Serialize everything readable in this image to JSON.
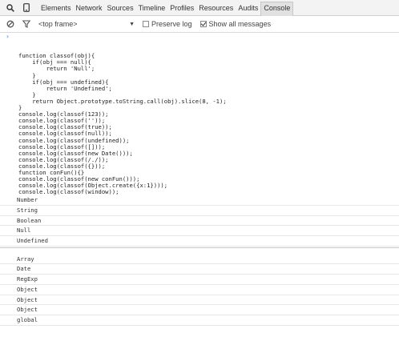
{
  "tabs": [
    "Elements",
    "Network",
    "Sources",
    "Timeline",
    "Profiles",
    "Resources",
    "Audits",
    "Console"
  ],
  "active_tab": "Console",
  "frame_select": "<top frame>",
  "preserve_log": {
    "label": "Preserve log",
    "checked": false
  },
  "show_all": {
    "label": "Show all messages",
    "checked": true
  },
  "code_lines": [
    "function classof(obj){",
    "    if(obj === null){",
    "        return 'Null';",
    "    }",
    "    if(obj === undefined){",
    "        return 'Undefined';",
    "    }",
    "    return Object.prototype.toString.call(obj).slice(8, -1);",
    "}",
    "console.log(classof(123));",
    "console.log(classof(''));",
    "console.log(classof(true));",
    "console.log(classof(null));",
    "console.log(classof(undefined));",
    "console.log(classof([]));",
    "console.log(classof(new Date()));",
    "console.log(classof(/./));",
    "console.log(classof({}));",
    "function conFun(){}",
    "console.log(classof(new conFun()));",
    "console.log(classof(Object.create({x:1})));",
    "console.log(classof(window));"
  ],
  "outputs_group1": [
    "Number",
    "String",
    "Boolean",
    "Null",
    "Undefined"
  ],
  "outputs_group2": [
    "Array",
    "Date",
    "RegExp",
    "Object",
    "Object",
    "Object",
    "global"
  ]
}
